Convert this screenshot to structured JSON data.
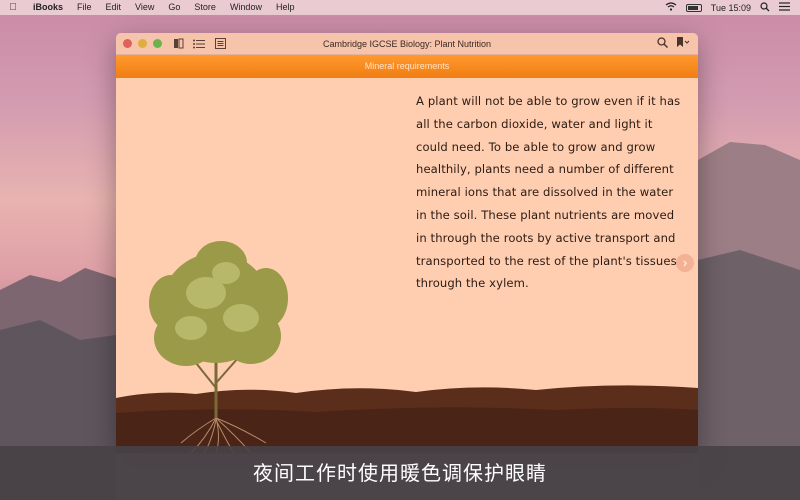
{
  "menubar": {
    "app_name": "iBooks",
    "items": [
      "File",
      "Edit",
      "View",
      "Go",
      "Store",
      "Window",
      "Help"
    ],
    "clock": "Tue 15:09"
  },
  "window": {
    "title": "Cambridge IGCSE Biology: Plant Nutrition",
    "chapter": "Mineral requirements"
  },
  "page": {
    "body": "A plant will not be able to grow even if it has all the carbon dioxide, water and light it could need. To be able to grow and grow healthily, plants need a number of different mineral ions that are dissolved in the water in the soil. These plant nutrients are moved in through the roots by active transport and transported to the rest of the plant's tissues through the xylem."
  },
  "caption": {
    "text": "夜间工作时使用暖色调保护眼睛"
  },
  "colors": {
    "chapter_bar": "#f38420",
    "page_bg": "#ffcdb0"
  },
  "icons": [
    "apple-icon",
    "wifi-icon",
    "battery-icon",
    "spotlight-icon",
    "notifications-icon",
    "library-icon",
    "toc-icon",
    "notes-icon",
    "search-icon",
    "bookmark-icon",
    "next-page-icon"
  ]
}
